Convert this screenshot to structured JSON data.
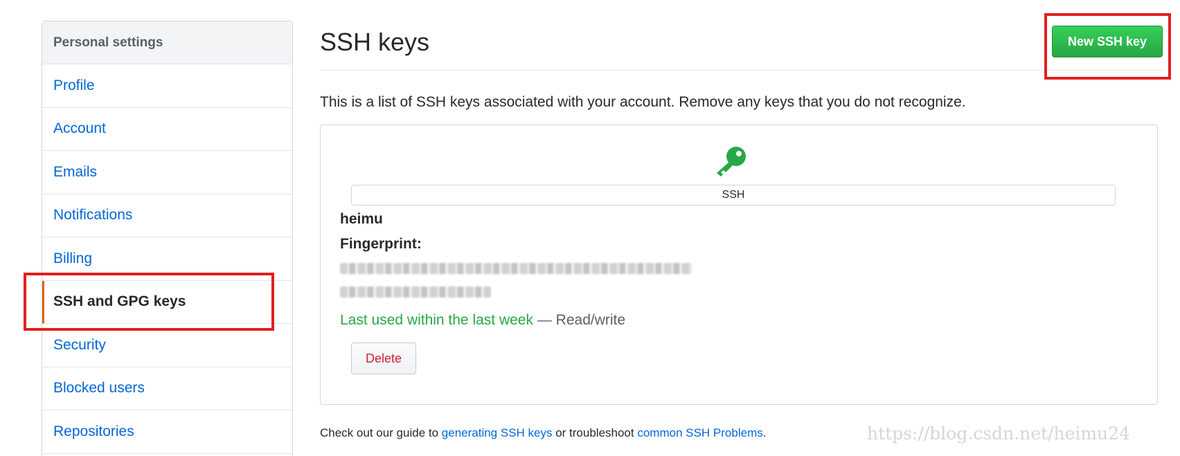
{
  "sidebar": {
    "header": "Personal settings",
    "items": [
      {
        "label": "Profile"
      },
      {
        "label": "Account"
      },
      {
        "label": "Emails"
      },
      {
        "label": "Notifications"
      },
      {
        "label": "Billing"
      },
      {
        "label": "SSH and GPG keys",
        "selected": true
      },
      {
        "label": "Security"
      },
      {
        "label": "Blocked users"
      },
      {
        "label": "Repositories"
      }
    ]
  },
  "main": {
    "title": "SSH keys",
    "new_key_button": "New SSH key",
    "intro": "This is a list of SSH keys associated with your account. Remove any keys that you do not recognize.",
    "key": {
      "type_badge": "SSH",
      "title": "heimu",
      "fingerprint_label": "Fingerprint:",
      "last_used": "Last used within the last week",
      "access": " — Read/write",
      "delete_button": "Delete"
    },
    "footer": {
      "prefix": "Check out our guide to ",
      "link1": "generating SSH keys",
      "middle": " or troubleshoot ",
      "link2": "common SSH Problems",
      "suffix": "."
    }
  },
  "watermark": "https://blog.csdn.net/heimu24",
  "colors": {
    "link": "#0366d6",
    "primary_button": "#28a745",
    "danger": "#cb2431",
    "selected_accent": "#e36209",
    "annotation": "#e02020"
  }
}
